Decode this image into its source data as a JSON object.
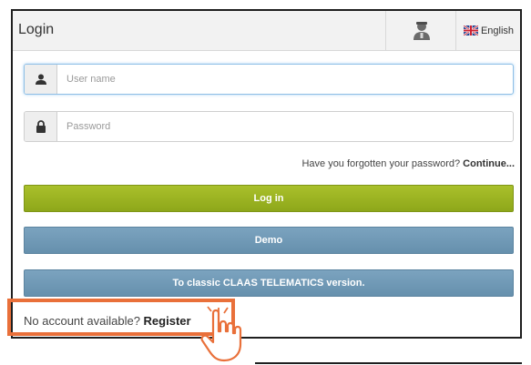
{
  "header": {
    "title": "Login",
    "avatar_icon": "user-avatar-icon",
    "language": {
      "flag_icon": "uk-flag-icon",
      "label": "English"
    }
  },
  "form": {
    "username": {
      "icon": "user-icon",
      "placeholder": "User name",
      "value": ""
    },
    "password": {
      "icon": "lock-icon",
      "placeholder": "Password",
      "value": ""
    },
    "forgot_text": "Have you forgotten your password?",
    "forgot_link": "Continue...",
    "login_label": "Log in",
    "demo_label": "Demo",
    "classic_label": "To classic CLAAS TELEMATICS version."
  },
  "register": {
    "text": "No account available?",
    "link": "Register"
  },
  "colors": {
    "login_button": "#9bb424",
    "secondary_button": "#7098b5",
    "highlight": "#e9703a"
  }
}
